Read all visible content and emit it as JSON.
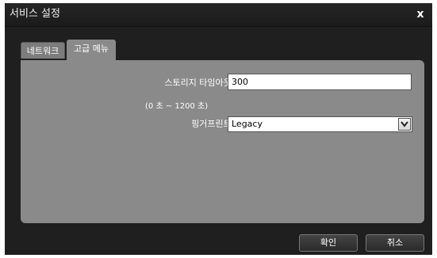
{
  "dialog": {
    "title": "서비스 설정",
    "close_symbol": "x"
  },
  "tabs": [
    {
      "label": "네트워크",
      "active": false
    },
    {
      "label": "고급 메뉴",
      "active": true
    }
  ],
  "form": {
    "storage_timeout_label": "스토리지 타임아웃 :",
    "storage_timeout_value": "300",
    "storage_timeout_range": "(0 초 ~ 1200 초)",
    "fingerprint_label": "핑거프린트 :",
    "fingerprint_selected": "Legacy"
  },
  "buttons": {
    "ok": "확인",
    "cancel": "취소"
  },
  "icons": {
    "close": "close-icon",
    "dropdown": "chevron-down-icon"
  }
}
